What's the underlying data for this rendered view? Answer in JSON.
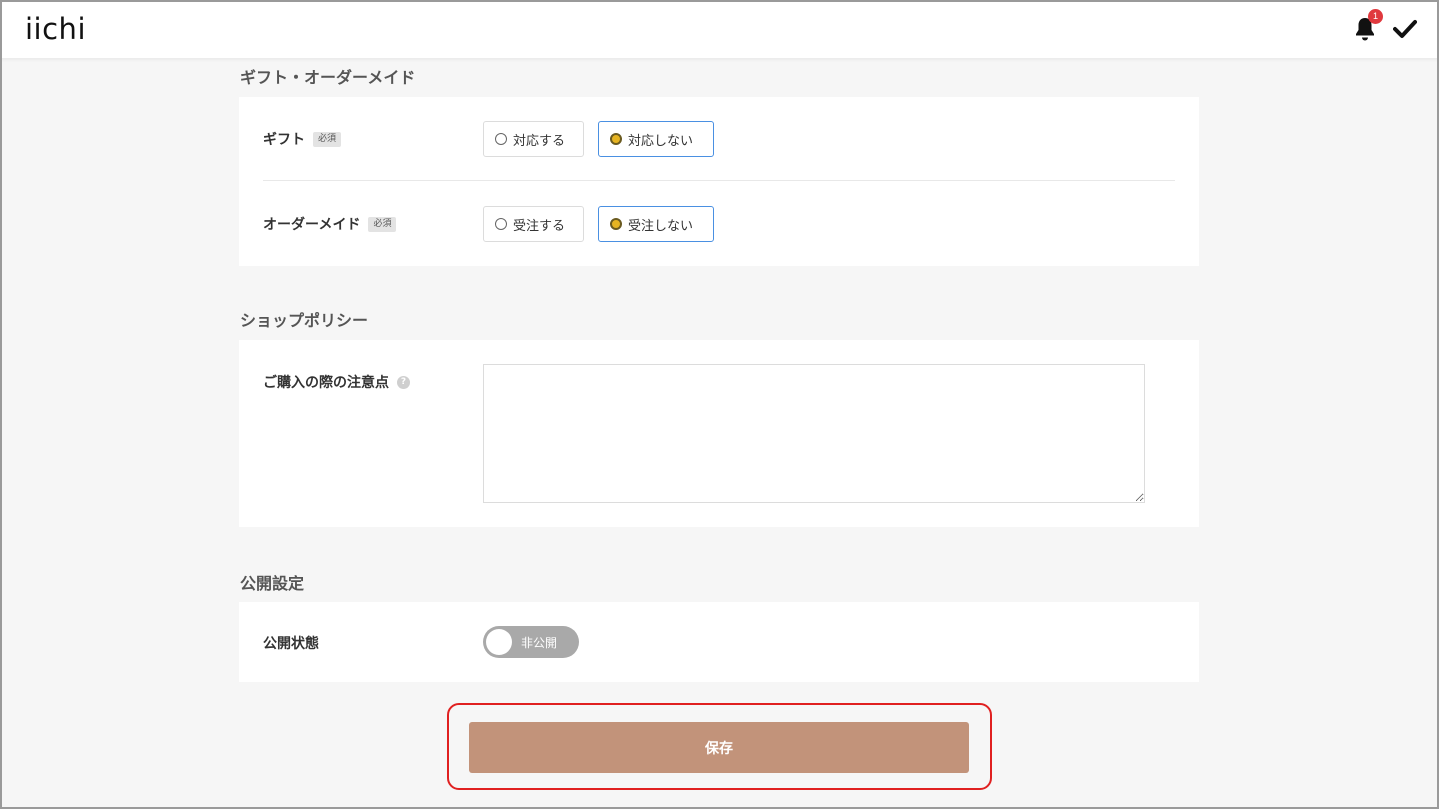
{
  "header": {
    "logo": "iichi",
    "notification_count": "1"
  },
  "gift_section": {
    "title": "ギフト・オーダーメイド",
    "gift": {
      "label": "ギフト",
      "required": "必須",
      "options": [
        "対応する",
        "対応しない"
      ],
      "selected": "対応しない"
    },
    "ordermade": {
      "label": "オーダーメイド",
      "required": "必須",
      "options": [
        "受注する",
        "受注しない"
      ],
      "selected": "受注しない"
    }
  },
  "policy_section": {
    "title": "ショップポリシー",
    "notes_label": "ご購入の際の注意点",
    "help_icon": "?",
    "notes_value": ""
  },
  "publish_section": {
    "title": "公開設定",
    "status_label": "公開状態",
    "toggle_text": "非公開"
  },
  "save_label": "保存",
  "colors": {
    "accent": "#c2937a",
    "selected_border": "#4a90e2",
    "radio_selected": "#e6b422",
    "badge": "#e0393e",
    "highlight": "#e02020"
  }
}
